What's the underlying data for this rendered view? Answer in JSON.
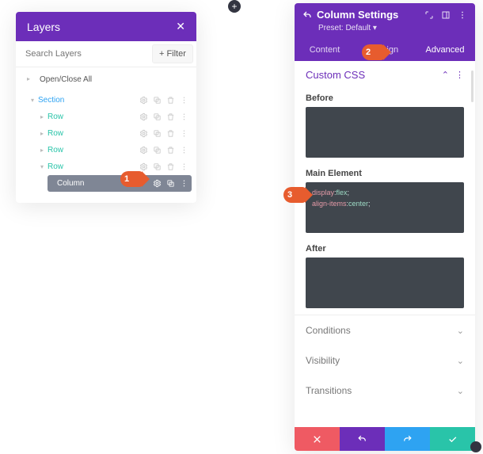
{
  "colors": {
    "brand": "#6c2eb9",
    "teal": "#29c4a9",
    "blue": "#2ea3f2",
    "red": "#ef5a63",
    "callout": "#e75c2e"
  },
  "layers": {
    "title": "Layers",
    "search_placeholder": "Search Layers",
    "filter_label": "Filter",
    "open_close_all": "Open/Close All",
    "section_label": "Section",
    "row_label": "Row",
    "column_label": "Column"
  },
  "settings": {
    "title": "Column Settings",
    "preset_label": "Preset: Default",
    "tabs": {
      "content": "Content",
      "design": "Design",
      "advanced": "Advanced"
    },
    "custom_css": {
      "heading": "Custom CSS",
      "before": "Before",
      "main": "Main Element",
      "after": "After",
      "code": {
        "p1": "display",
        "v1": "flex",
        "p2": "align-items",
        "v2": "center"
      }
    },
    "accordion": {
      "conditions": "Conditions",
      "visibility": "Visibility",
      "transitions": "Transitions"
    }
  },
  "callouts": {
    "one": "1",
    "two": "2",
    "three": "3"
  }
}
